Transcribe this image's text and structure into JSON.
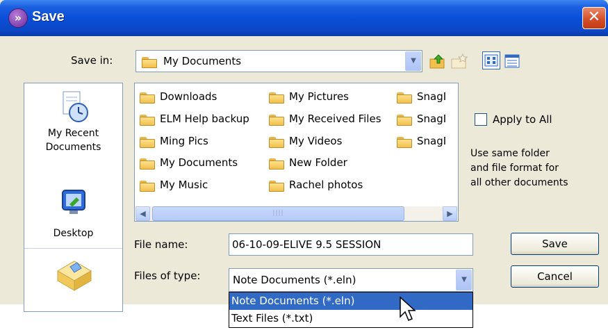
{
  "window": {
    "title": "Save"
  },
  "save_in": {
    "label": "Save in:",
    "value": "My Documents"
  },
  "places": [
    {
      "label_line1": "My Recent",
      "label_line2": "Documents",
      "icon": "recent-documents-icon"
    },
    {
      "label_line1": "Desktop",
      "label_line2": "",
      "icon": "desktop-icon"
    },
    {
      "label_line1": "",
      "label_line2": "",
      "icon": "my-documents-icon"
    }
  ],
  "files": {
    "col1": [
      "Downloads",
      "ELM Help backup",
      "Ming Pics",
      "My Documents",
      "My Music"
    ],
    "col2": [
      "My Pictures",
      "My Received Files",
      "My Videos",
      "New Folder",
      "Rachel photos"
    ],
    "col3": [
      "SnagI",
      "SnagI",
      "SnagI"
    ]
  },
  "apply_all": {
    "label": "Apply to All",
    "checked": false,
    "note_line1": "Use same folder",
    "note_line2": "and file format for",
    "note_line3": "all other documents"
  },
  "file_name": {
    "label": "File name:",
    "value": "06-10-09-ELIVE 9.5 SESSION"
  },
  "file_type": {
    "label": "Files of type:",
    "value": "Note Documents (*.eln)",
    "options": [
      "Note Documents (*.eln)",
      "Text Files (*.txt)"
    ],
    "highlighted": 0
  },
  "buttons": {
    "save": "Save",
    "cancel": "Cancel"
  },
  "colors": {
    "title_bar": "#0a4fd8",
    "dialog_bg": "#ece9d8",
    "highlight": "#316ac5",
    "close": "#d4502a"
  }
}
